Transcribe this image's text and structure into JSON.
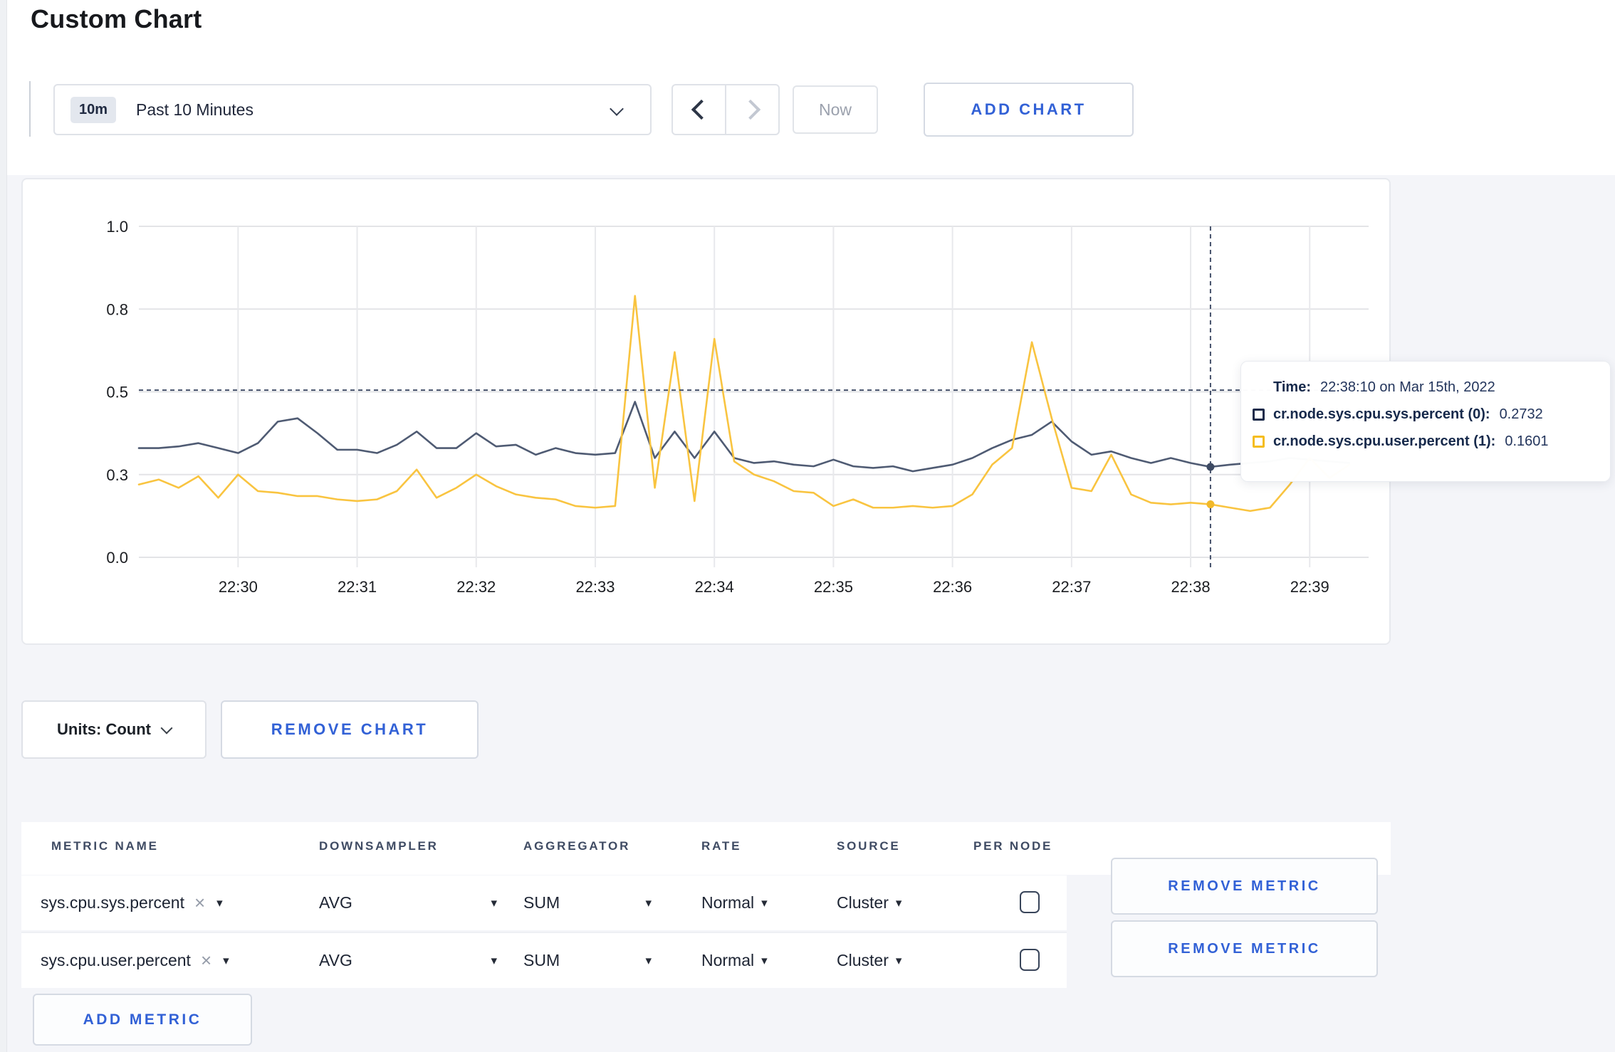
{
  "page": {
    "title": "Custom Chart",
    "background_color": "#f4f5f9",
    "accent_blue": "#3261d6"
  },
  "toolbar": {
    "time_badge": "10m",
    "time_label": "Past 10 Minutes",
    "prev_icon": "chevron-left",
    "next_icon": "chevron-right",
    "now_label": "Now",
    "add_chart_label": "ADD CHART"
  },
  "chart": {
    "units_label": "Units: Count",
    "remove_chart_label": "REMOVE CHART",
    "tooltip": {
      "time_label": "Time:",
      "time_value": "22:38:10 on Mar 15th, 2022",
      "rows": [
        {
          "label": "cr.node.sys.cpu.sys.percent (0):",
          "value": "0.2732",
          "color": "#1c2b4a"
        },
        {
          "label": "cr.node.sys.cpu.user.percent (1):",
          "value": "0.1601",
          "color": "#f5bd1f"
        }
      ]
    }
  },
  "chart_data": {
    "type": "line",
    "title": "",
    "xlabel": "",
    "ylabel": "",
    "x_start": "22:29:10",
    "x_end": "22:39:20",
    "x_step_seconds": 10,
    "x_ticks": [
      "22:30",
      "22:31",
      "22:32",
      "22:33",
      "22:34",
      "22:35",
      "22:36",
      "22:37",
      "22:38",
      "22:39"
    ],
    "y_tick_labels": [
      "0.0",
      "0.3",
      "0.5",
      "0.8",
      "1.0"
    ],
    "y_tick_values": [
      0,
      0.25,
      0.5,
      0.75,
      1.0
    ],
    "ylim": [
      0,
      1
    ],
    "grid": true,
    "series": [
      {
        "name": "cr.node.sys.cpu.sys.percent",
        "color": "#4f5b73",
        "values": [
          0.33,
          0.33,
          0.335,
          0.345,
          0.33,
          0.315,
          0.345,
          0.41,
          0.42,
          0.375,
          0.325,
          0.325,
          0.315,
          0.34,
          0.38,
          0.33,
          0.33,
          0.375,
          0.335,
          0.34,
          0.31,
          0.33,
          0.315,
          0.31,
          0.315,
          0.47,
          0.3,
          0.38,
          0.3,
          0.38,
          0.3,
          0.285,
          0.29,
          0.28,
          0.275,
          0.295,
          0.275,
          0.27,
          0.275,
          0.26,
          0.27,
          0.28,
          0.3,
          0.33,
          0.355,
          0.37,
          0.41,
          0.35,
          0.31,
          0.32,
          0.3,
          0.285,
          0.3,
          0.285,
          0.2732,
          0.28,
          0.285,
          0.29,
          0.3,
          0.295,
          0.29,
          0.285
        ]
      },
      {
        "name": "cr.node.sys.cpu.user.percent",
        "color": "#f9c440",
        "values": [
          0.22,
          0.235,
          0.21,
          0.245,
          0.18,
          0.25,
          0.2,
          0.195,
          0.185,
          0.185,
          0.175,
          0.17,
          0.175,
          0.2,
          0.265,
          0.18,
          0.21,
          0.25,
          0.215,
          0.19,
          0.18,
          0.175,
          0.155,
          0.15,
          0.155,
          0.79,
          0.21,
          0.62,
          0.17,
          0.66,
          0.29,
          0.25,
          0.23,
          0.2,
          0.195,
          0.155,
          0.175,
          0.15,
          0.15,
          0.155,
          0.15,
          0.155,
          0.19,
          0.28,
          0.33,
          0.65,
          0.42,
          0.21,
          0.2,
          0.31,
          0.19,
          0.165,
          0.16,
          0.165,
          0.1601,
          0.15,
          0.14,
          0.15,
          0.22,
          0.3,
          0.24,
          0.28
        ]
      }
    ],
    "crosshair": {
      "x_index": 54,
      "time": "22:38:10",
      "mouse_value": 0.505,
      "values": [
        0.2732,
        0.1601
      ]
    },
    "legend_position": "tooltip-only"
  },
  "metrics_table": {
    "headers": [
      "METRIC NAME",
      "DOWNSAMPLER",
      "AGGREGATOR",
      "RATE",
      "SOURCE",
      "PER NODE"
    ],
    "rows": [
      {
        "metric": "sys.cpu.sys.percent",
        "remove_icon": "×",
        "downsampler": "AVG",
        "aggregator": "SUM",
        "rate": "Normal",
        "source": "Cluster",
        "per_node_checked": false,
        "remove_label": "REMOVE METRIC"
      },
      {
        "metric": "sys.cpu.user.percent",
        "remove_icon": "×",
        "downsampler": "AVG",
        "aggregator": "SUM",
        "rate": "Normal",
        "source": "Cluster",
        "per_node_checked": false,
        "remove_label": "REMOVE METRIC"
      }
    ],
    "caret_icon": "▾",
    "add_metric_label": "ADD METRIC"
  }
}
